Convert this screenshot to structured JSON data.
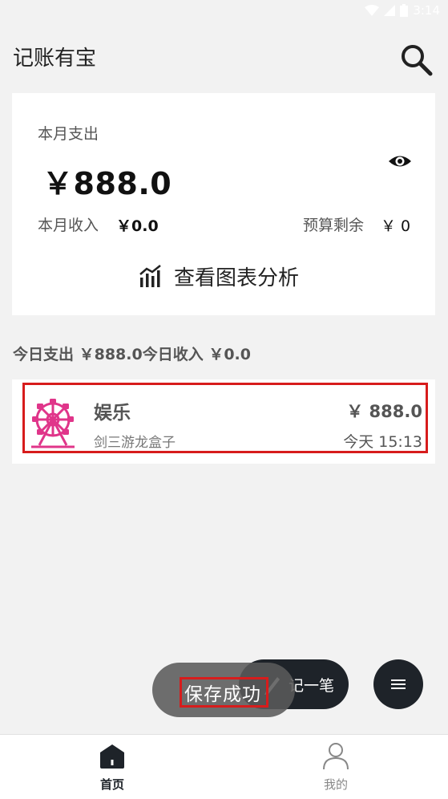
{
  "status_bar": {
    "time": "3:14"
  },
  "app_bar": {
    "title": "记账有宝",
    "search_icon": "search-icon"
  },
  "summary_card": {
    "month_expense_label": "本月支出",
    "month_expense_amount": "￥888.0",
    "visibility_icon": "eye-icon",
    "month_income_label": "本月收入",
    "month_income_value": "￥0.0",
    "budget_remaining_label": "预算剩余",
    "budget_remaining_value": "￥ 0",
    "chart_link_label": "查看图表分析",
    "chart_link_icon": "chart-icon"
  },
  "daily_summary": "今日支出 ￥888.0今日收入 ￥0.0",
  "transactions": [
    {
      "category": "娱乐",
      "note": "剑三游龙盒子",
      "amount": "￥ 888.0",
      "time": "今天 15:13",
      "icon": "ferris-wheel-icon",
      "icon_color": "#e0358a"
    }
  ],
  "fab": {
    "record_label": "记一笔",
    "record_icon": "pen-icon",
    "menu_icon": "menu-icon"
  },
  "toast": {
    "text": "保存成功"
  },
  "bottom_nav": [
    {
      "label": "首页",
      "icon": "home-icon",
      "active": true
    },
    {
      "label": "我的",
      "icon": "user-icon",
      "active": false
    }
  ],
  "colors": {
    "background": "#f2f2f2",
    "card": "#ffffff",
    "dark_button": "#1e2329",
    "highlight_border": "#d71c1c",
    "category_icon": "#e0358a"
  }
}
